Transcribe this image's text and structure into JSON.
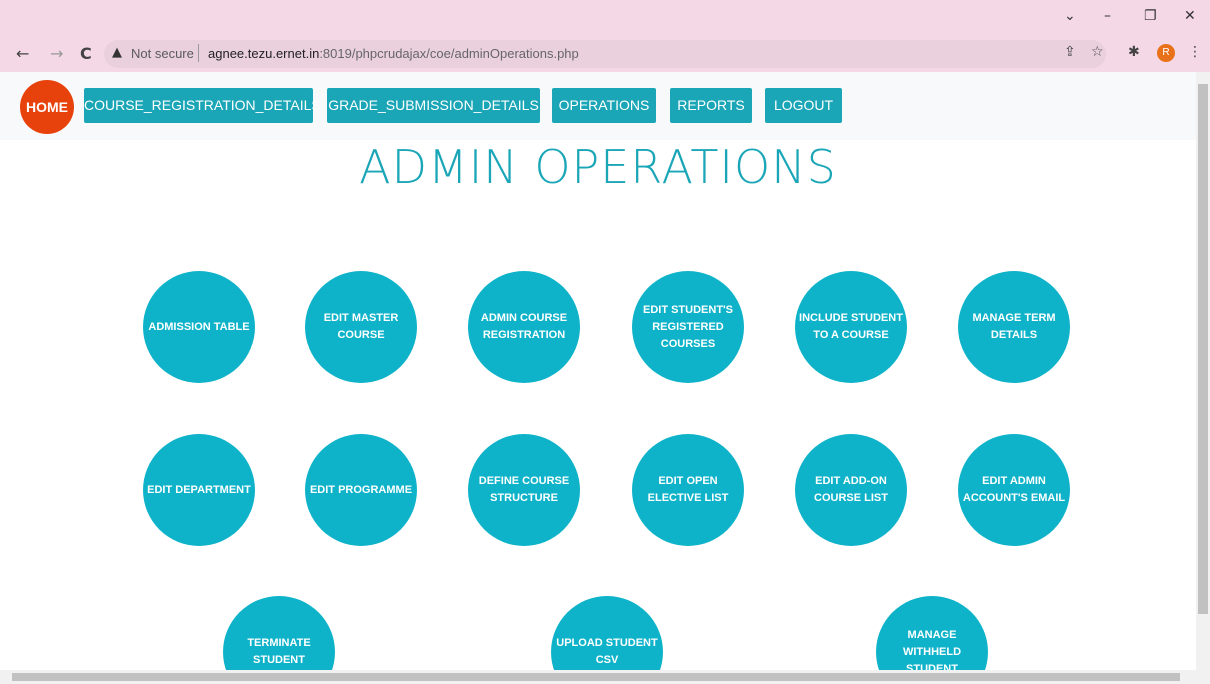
{
  "browser": {
    "window_controls": {
      "collapse": "⌄",
      "minimize": "–",
      "restore": "❐",
      "close": "✕"
    },
    "back_icon": "←",
    "forward_icon": "→",
    "reload_icon": "C",
    "warning_icon": "▲",
    "security_label": "Not secure",
    "url_host": "agnee.tezu.ernet.in",
    "url_path": ":8019/phpcrudajax/coe/adminOperations.php",
    "share_icon": "⇪",
    "star_icon": "☆",
    "extensions_icon": "✱",
    "profile_initial": "R",
    "menu_icon": "⋮"
  },
  "nav": {
    "home": "HOME",
    "links": [
      "COURSE_REGISTRATION_DETAILS",
      "GRADE_SUBMISSION_DETAILS",
      "OPERATIONS",
      "REPORTS",
      "LOGOUT"
    ]
  },
  "page_title": "ADMIN OPERATIONS",
  "operations": [
    "ADMISSION TABLE",
    "EDIT MASTER COURSE",
    "ADMIN COURSE REGISTRATION",
    "EDIT STUDENT'S REGISTERED COURSES",
    "INCLUDE STUDENT TO A COURSE",
    "MANAGE TERM DETAILS",
    "EDIT DEPARTMENT",
    "EDIT PROGRAMME",
    "DEFINE COURSE STRUCTURE",
    "EDIT OPEN ELECTIVE LIST",
    "EDIT ADD-ON COURSE LIST",
    "EDIT ADMIN ACCOUNT'S EMAIL",
    "TERMINATE STUDENT",
    "UPLOAD STUDENT CSV",
    "MANAGE WITHHELD STUDENT"
  ],
  "colors": {
    "accent": "#1aa6b7",
    "circle": "#0fb3c9",
    "home": "#e8420c",
    "chrome": "#f5d8e6"
  }
}
